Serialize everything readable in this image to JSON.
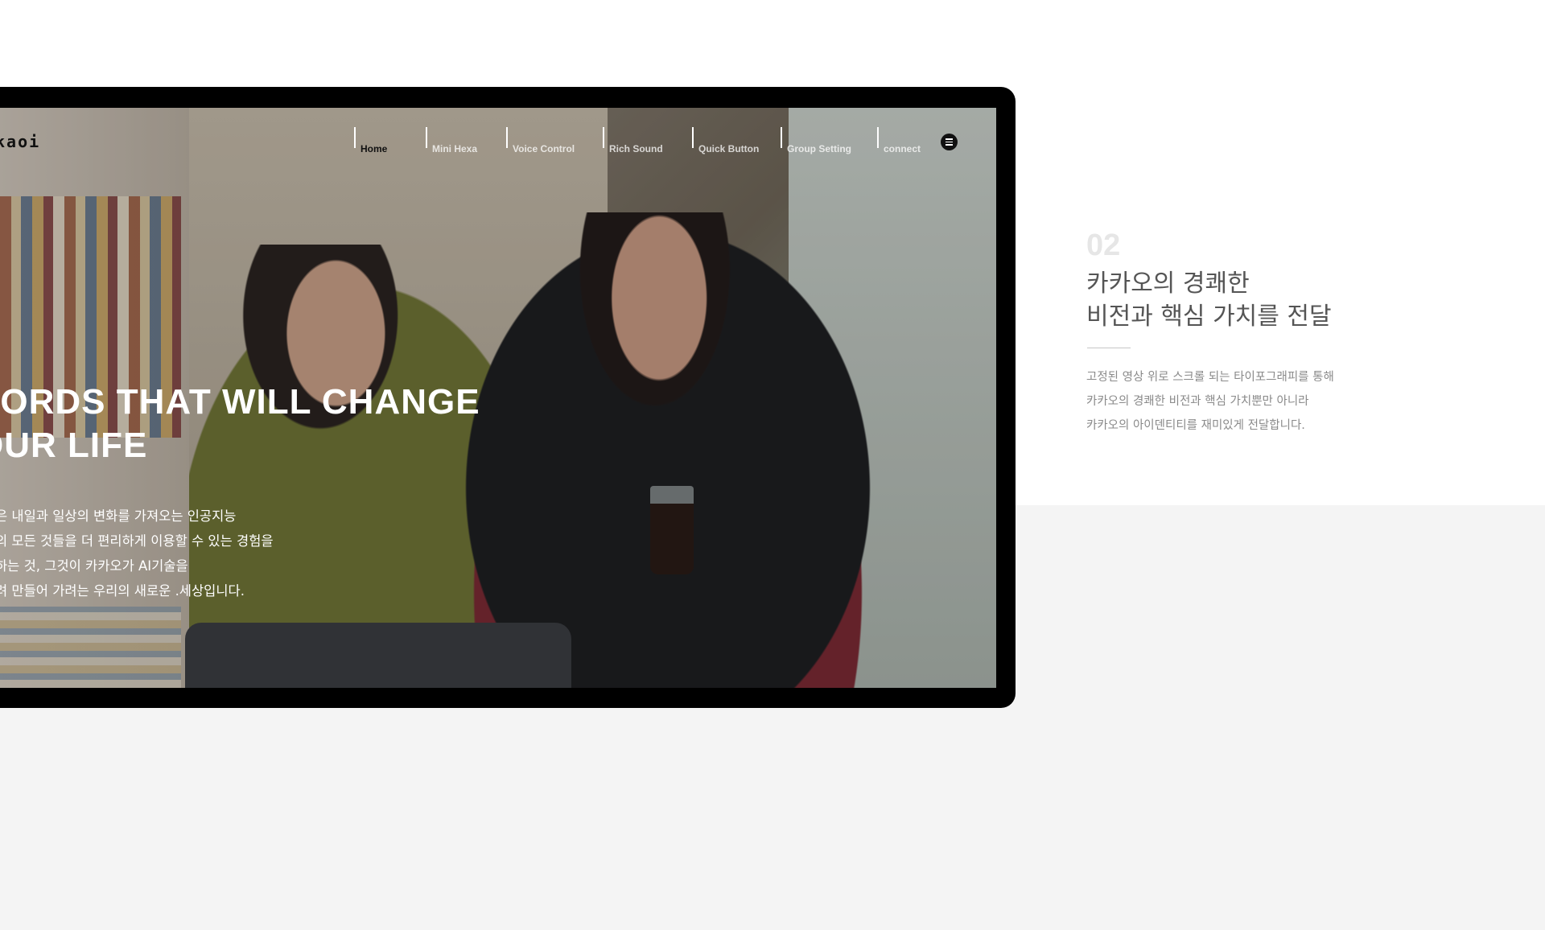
{
  "brand": {
    "logo_text": "kaoi"
  },
  "nav": {
    "items": [
      {
        "label": "Home",
        "active": true
      },
      {
        "label": "Mini Hexa",
        "active": false
      },
      {
        "label": "Voice Control",
        "active": false
      },
      {
        "label": "Rich Sound",
        "active": false
      },
      {
        "label": "Quick Button",
        "active": false
      },
      {
        "label": "Group Setting",
        "active": false
      },
      {
        "label": "connect",
        "active": false
      }
    ],
    "menu_icon": "hamburger-menu-icon"
  },
  "hero": {
    "title_line1": "VORDS THAT WILL CHANGE",
    "title_line2": "OUR LIFE",
    "desc_lines": [
      "은 내일과 일상의 변화를 가져오는 인공지능",
      "의 모든 것들을 더 편리하게 이용할 수 있는 경험을",
      "하는 것, 그것이 카카오가 AI기술을",
      "려 만들어 가려는 우리의 새로운 .세상입니다."
    ]
  },
  "feature": {
    "number": "02",
    "headline_line1": "카카오의 경쾌한",
    "headline_line2": "비전과 핵심 가치를 전달",
    "body_lines": [
      "고정된 영상 위로 스크롤 되는 타이포그래피를 통해",
      "카카오의 경쾌한 비전과 핵심 가치뿐만 아니라",
      "카카오의 아이덴티티를 재미있게 전달합니다."
    ]
  },
  "colors": {
    "frame": "#000000",
    "page_top": "#ffffff",
    "page_bottom": "#f4f4f4",
    "headline": "#555555",
    "body": "#8a8a8a",
    "number": "#e6e6e6"
  }
}
